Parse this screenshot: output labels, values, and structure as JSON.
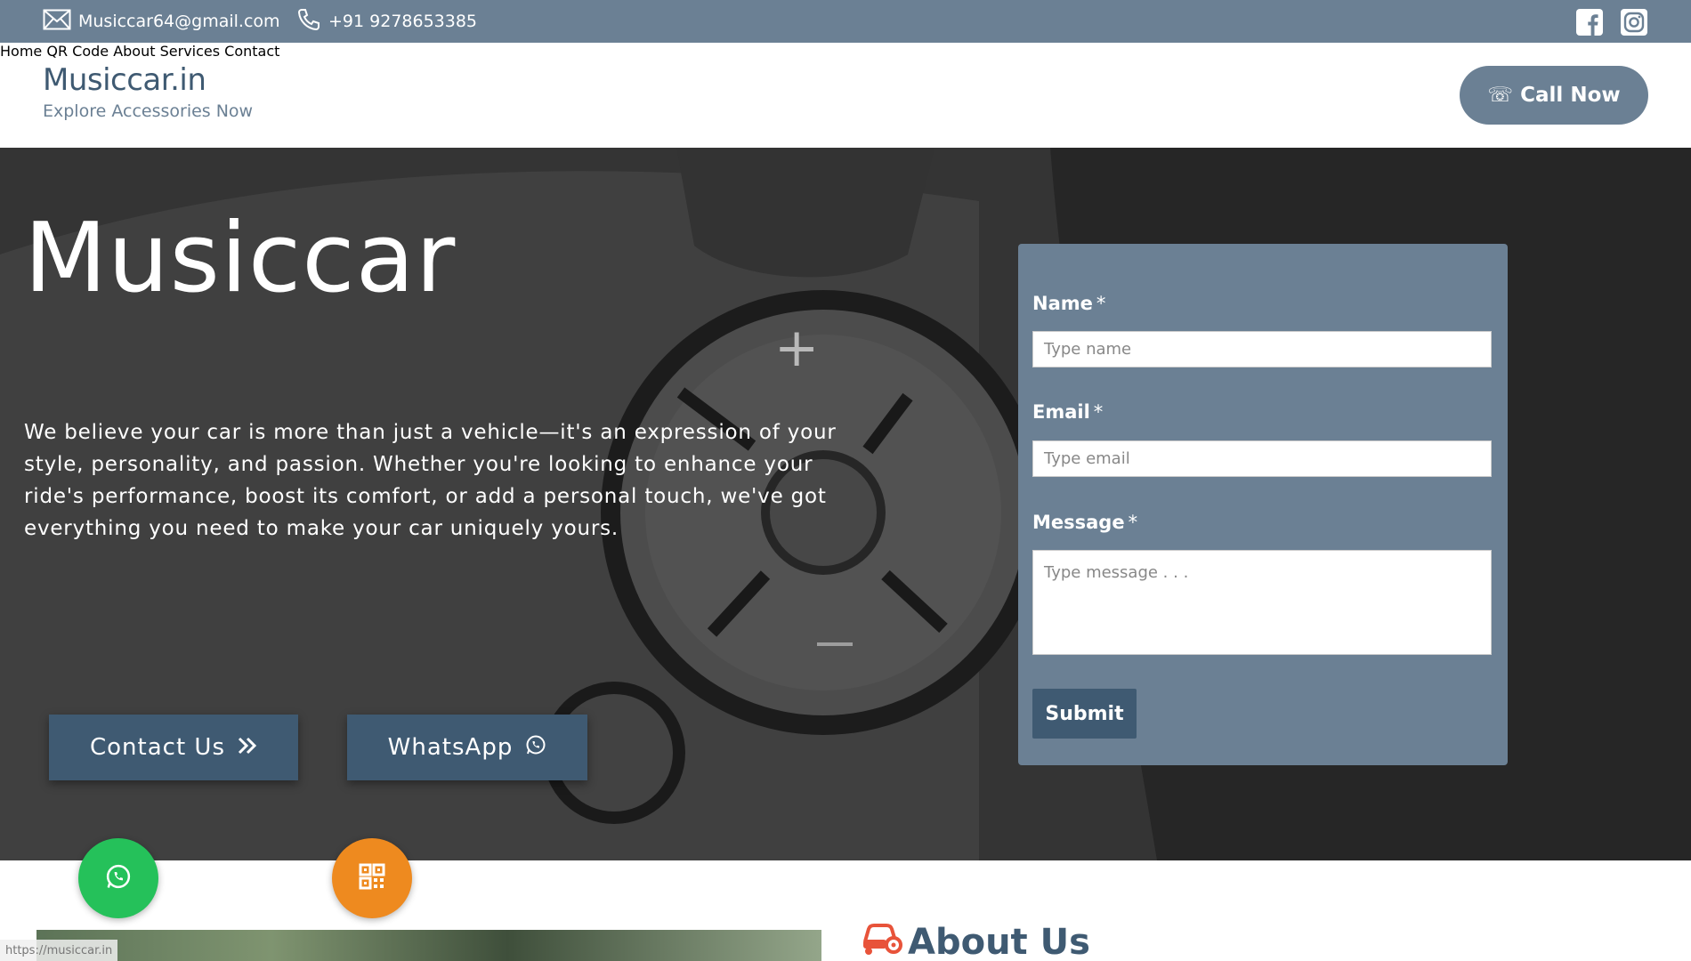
{
  "topbar": {
    "email": "Musiccar64@gmail.com",
    "phone": "+91 9278653385",
    "icons": [
      "mail-icon",
      "phone-icon",
      "facebook-icon",
      "instagram-icon"
    ]
  },
  "header": {
    "brand_name": "Musiccar.in",
    "brand_tagline": "Explore Accessories Now",
    "nav": [
      {
        "label": "Home"
      },
      {
        "label": "QR Code"
      },
      {
        "label": "About"
      },
      {
        "label": "Services"
      },
      {
        "label": "Contact"
      }
    ],
    "call_button": "☏ Call Now"
  },
  "hero": {
    "title": "Musiccar",
    "text": "We believe your car is more than just a vehicle—it's an expression of your style, personality, and passion. Whether you're looking to enhance your ride's performance, boost its comfort, or add a personal touch, we've got everything you need to make your car uniquely yours.",
    "contact_button": "Contact Us",
    "whatsapp_button": "WhatsApp"
  },
  "form": {
    "name_label": "Name",
    "name_placeholder": "Type name",
    "email_label": "Email",
    "email_placeholder": "Type email",
    "message_label": "Message",
    "message_placeholder": "Type message . . .",
    "required_mark": "*",
    "submit": "Submit"
  },
  "about": {
    "title": "About Us"
  },
  "status_bar": {
    "url": "https://musiccar.in"
  },
  "colors": {
    "slate": "#6b8094",
    "navy": "#3f5a72",
    "whatsapp_green": "#25c15a",
    "qr_orange": "#ee8a1f"
  }
}
